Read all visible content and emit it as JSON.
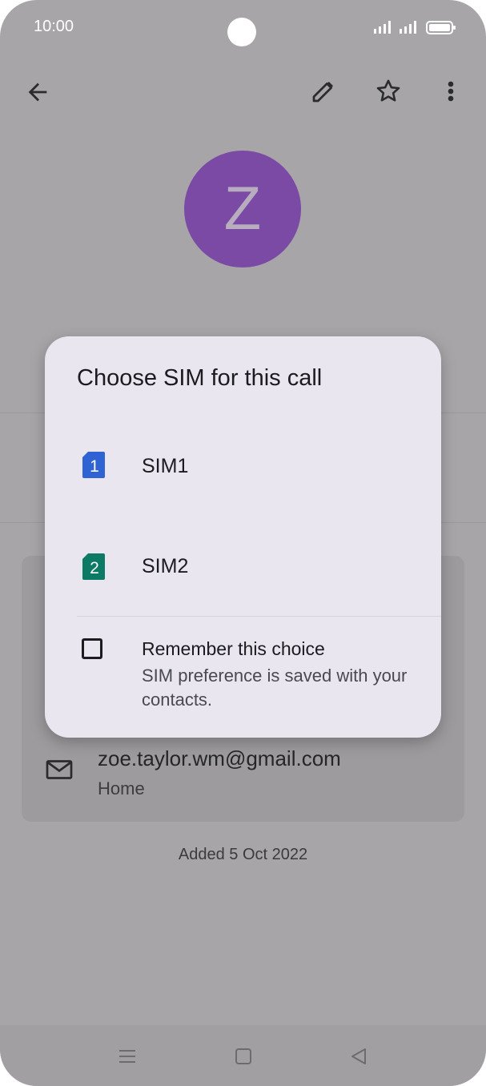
{
  "status_bar": {
    "time": "10:00"
  },
  "contact": {
    "initial": "Z",
    "email": "zoe.taylor.wm@gmail.com",
    "email_type": "Home",
    "added": "Added 5 Oct 2022"
  },
  "dialog": {
    "title": "Choose SIM for this call",
    "options": [
      {
        "number": "1",
        "label": "SIM1",
        "color": "#2f63d4"
      },
      {
        "number": "2",
        "label": "SIM2",
        "color": "#0c7a64"
      }
    ],
    "remember_title": "Remember this choice",
    "remember_subtitle": "SIM preference is saved with your contacts."
  },
  "colors": {
    "scrim": "#a7a5a8",
    "avatar": "#7a4aa5",
    "dialog_bg": "#e9e6f0"
  },
  "icons": [
    "back-arrow-icon",
    "edit-pencil-icon",
    "star-icon",
    "more-vert-icon",
    "email-icon",
    "nav-recents-icon",
    "nav-home-icon",
    "nav-back-icon"
  ]
}
